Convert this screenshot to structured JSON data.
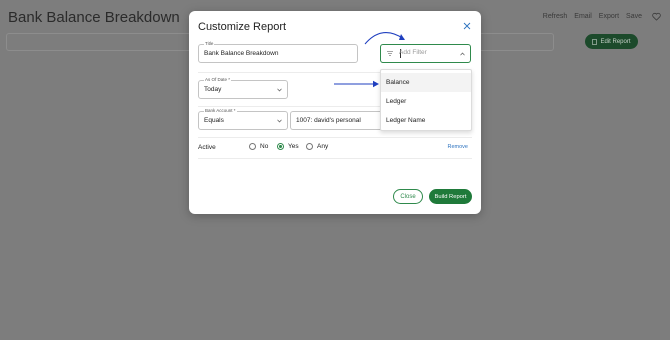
{
  "page": {
    "title": "Bank Balance Breakdown",
    "actions": [
      "Refresh",
      "Email",
      "Export",
      "Save"
    ],
    "edit_report_label": "Edit Report"
  },
  "modal": {
    "title": "Customize Report",
    "title_field": {
      "label": "Title",
      "value": "Bank Balance Breakdown"
    },
    "add_filter": {
      "placeholder": "Add Filter"
    },
    "as_of_date": {
      "label": "As Of Date *",
      "value": "Today"
    },
    "bank_account": {
      "label": "Bank Account *",
      "operator": "Equals",
      "value": "1007: david's personal"
    },
    "active": {
      "label": "Active",
      "options": [
        "No",
        "Yes",
        "Any"
      ],
      "selected": "Yes",
      "remove_label": "Remove"
    },
    "close_label": "Close",
    "build_label": "Build Report"
  },
  "dropdown": {
    "options": [
      "Balance",
      "Ledger",
      "Ledger Name"
    ],
    "highlighted": "Balance"
  },
  "colors": {
    "accent": "#2f8a4c",
    "primary_button": "#1f7a3a",
    "annotation_arrow": "#1f3fbf",
    "overlay": "#7d7d7d"
  }
}
